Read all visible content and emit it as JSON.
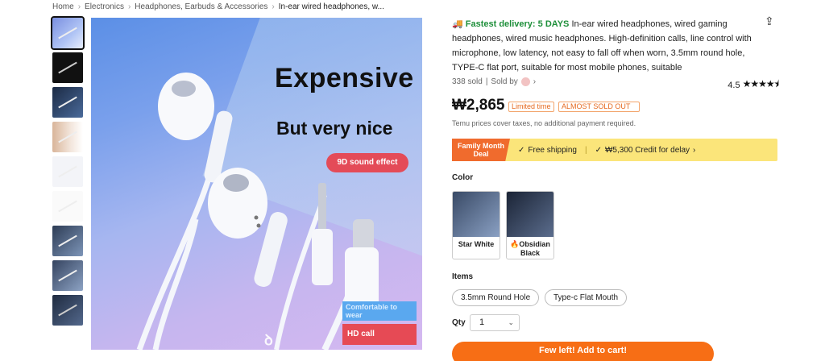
{
  "breadcrumb": {
    "items": [
      "Home",
      "Electronics",
      "Headphones, Earbuds & Accessories",
      "In-ear wired headphones, w..."
    ]
  },
  "gallery": {
    "hero_title": "Expensive",
    "hero_subtitle": "But very nice",
    "pill_text": "9D sound effect",
    "badge_blue": "Comfortable to wear",
    "badge_red": "HD call",
    "thumbnail_count": 9
  },
  "product": {
    "fast_delivery": "Fastest delivery: 5 DAYS",
    "title": "In-ear wired headphones, wired gaming headphones, wired music headphones. High-definition calls, line control with microphone, low latency, not easy to fall off when worn, 3.5mm round hole, TYPE-C flat port, suitable for most mobile phones, suitable",
    "sold": "338 sold",
    "sold_by": "Sold by",
    "rating": "4.5",
    "price": "₩2,865",
    "tag_limited": "Limited time",
    "tag_almost": "ALMOST SOLD OUT",
    "tax_note": "Temu prices cover taxes, no additional payment required."
  },
  "deal": {
    "tag": "Family Month Deal",
    "free_shipping": "Free shipping",
    "credit": "₩5,300 Credit for delay"
  },
  "color": {
    "label": "Color",
    "options": [
      "Star White",
      "Obsidian Black"
    ]
  },
  "items": {
    "label": "Items",
    "options": [
      "3.5mm Round Hole",
      "Type-c Flat Mouth"
    ]
  },
  "qty": {
    "label": "Qty",
    "value": "1"
  },
  "cart": {
    "label": "Few left! Add to cart!"
  },
  "colors": {
    "accent": "#f76e15",
    "green": "#1e8f3a",
    "deal_bg": "#fbe57a"
  }
}
